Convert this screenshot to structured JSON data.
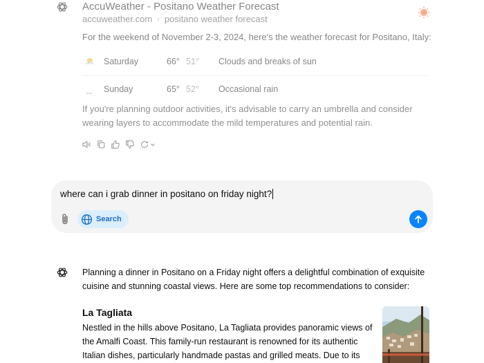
{
  "source_card": {
    "title": "AccuWeather - Positano Weather Forecast",
    "domain": "accuweather.com",
    "breadcrumb": "positano weather forecast",
    "intro": "For the weekend of November 2-3, 2024, here's the weather forecast for Positano, Italy:"
  },
  "forecast": [
    {
      "icon": "partly-sunny-icon",
      "day": "Saturday",
      "high": "66°",
      "low": "51°",
      "condition": "Clouds and breaks of sun"
    },
    {
      "icon": "rain-icon",
      "day": "Sunday",
      "high": "65°",
      "low": "52°",
      "condition": "Occasional rain"
    }
  ],
  "advice": "If you're planning outdoor activities, it's advisable to carry an umbrella and consider wearing layers to accommodate the mild temperatures and potential rain.",
  "message_actions": [
    "read-aloud-icon",
    "copy-icon",
    "thumbs-up-icon",
    "thumbs-down-icon",
    "regenerate-icon"
  ],
  "composer": {
    "text": "where can i grab dinner in positano on friday night?",
    "search_label": "Search"
  },
  "response": {
    "intro": "Planning a dinner in Positano on a Friday night offers a delightful combination of exquisite cuisine and stunning coastal views. Here are some top recommendations to consider:",
    "restaurant_name": "La Tagliata",
    "restaurant_text": "Nestled in the hills above Positano, La Tagliata provides panoramic views of the Amalfi Coast. This family-run restaurant is renowned for its authentic Italian dishes, particularly handmade pastas and grilled meats. Due to its popularity, especially on"
  },
  "colors": {
    "accent": "#0a84ff",
    "search_pill_bg": "#dbeefc",
    "composer_bg": "#f4f4f4",
    "accuweather_orange": "#f26a2e"
  }
}
